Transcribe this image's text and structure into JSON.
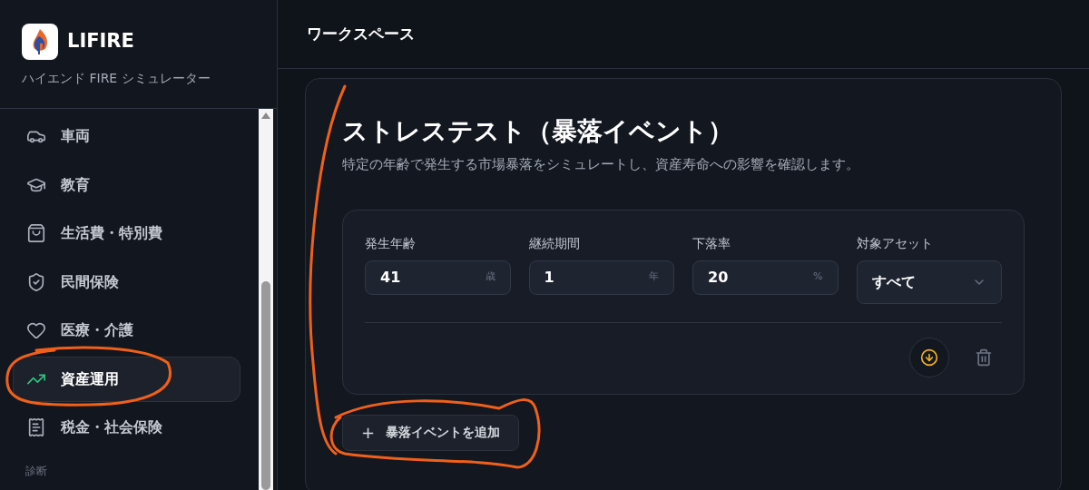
{
  "app": {
    "name": "LIFIRE",
    "tagline": "ハイエンド FIRE シミュレーター"
  },
  "sidebar": {
    "items": [
      {
        "label": "車両",
        "selected": false
      },
      {
        "label": "教育",
        "selected": false
      },
      {
        "label": "生活費・特別費",
        "selected": false
      },
      {
        "label": "民間保険",
        "selected": false
      },
      {
        "label": "医療・介護",
        "selected": false
      },
      {
        "label": "資産運用",
        "selected": true
      },
      {
        "label": "税金・社会保険",
        "selected": false
      }
    ],
    "section_label": "診断"
  },
  "header": {
    "title": "ワークスペース"
  },
  "stress_test": {
    "title": "ストレステスト（暴落イベント）",
    "description": "特定の年齢で発生する市場暴落をシミュレートし、資産寿命への影響を確認します。",
    "fields": [
      {
        "kind": "number",
        "label": "発生年齢",
        "value": "41",
        "unit": "歳"
      },
      {
        "kind": "number",
        "label": "継続期間",
        "value": "1",
        "unit": "年"
      },
      {
        "kind": "number",
        "label": "下落率",
        "value": "20",
        "unit": "%"
      },
      {
        "kind": "select",
        "label": "対象アセット",
        "value": "すべて"
      }
    ],
    "add_button": {
      "icon": "+",
      "label": "暴落イベントを追加"
    }
  }
}
